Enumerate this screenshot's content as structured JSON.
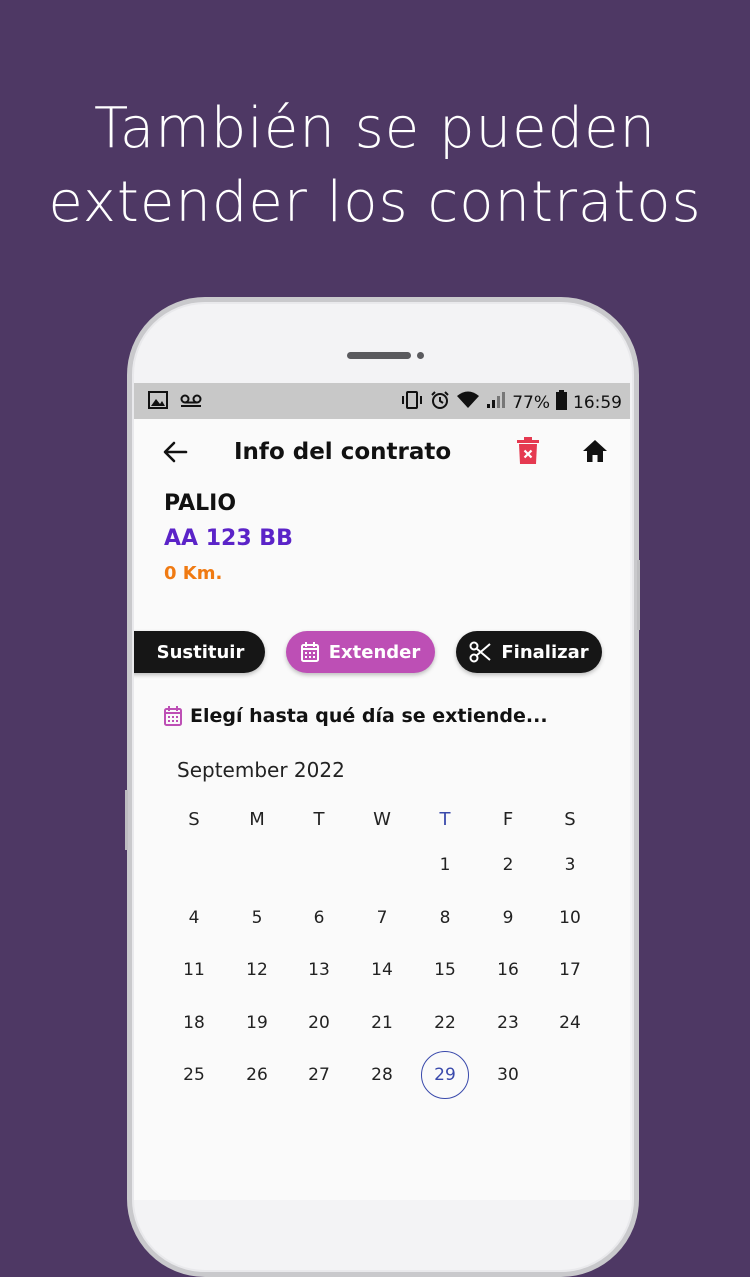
{
  "headline": {
    "line1": "También se pueden",
    "line2": "extender los contratos"
  },
  "status_bar": {
    "left_icons": [
      "image-icon",
      "voicemail-icon"
    ],
    "right_icons": [
      "vibrate-icon",
      "alarm-icon",
      "wifi-icon",
      "signal-icon",
      "battery-icon"
    ],
    "battery": "77%",
    "time": "16:59"
  },
  "app_bar": {
    "title": "Info del contrato",
    "back_icon": "arrow-left-icon",
    "delete_icon": "trash-icon",
    "home_icon": "home-icon"
  },
  "vehicle": {
    "model": "PALIO",
    "plate": "AA 123 BB",
    "km": "0 Km."
  },
  "actions": {
    "sustituir": "Sustituir",
    "extender": "Extender",
    "finalizar": "Finalizar"
  },
  "picker": {
    "prompt": "Elegí hasta qué día se extiende...",
    "month": "September 2022",
    "weekdays": [
      "S",
      "M",
      "T",
      "W",
      "T",
      "F",
      "S"
    ],
    "today_weekday_index": 4,
    "weeks": [
      [
        "",
        "",
        "",
        "",
        "1",
        "2",
        "3"
      ],
      [
        "4",
        "5",
        "6",
        "7",
        "8",
        "9",
        "10"
      ],
      [
        "11",
        "12",
        "13",
        "14",
        "15",
        "16",
        "17"
      ],
      [
        "18",
        "19",
        "20",
        "21",
        "22",
        "23",
        "24"
      ],
      [
        "25",
        "26",
        "27",
        "28",
        "29",
        "30",
        ""
      ]
    ],
    "selected_day": "29"
  },
  "colors": {
    "background": "#4e3864",
    "plate": "#5b23c8",
    "km": "#f07a12",
    "extender": "#bd4fb5",
    "dark_pill": "#161616",
    "delete": "#e53950",
    "accent": "#3949ab"
  }
}
